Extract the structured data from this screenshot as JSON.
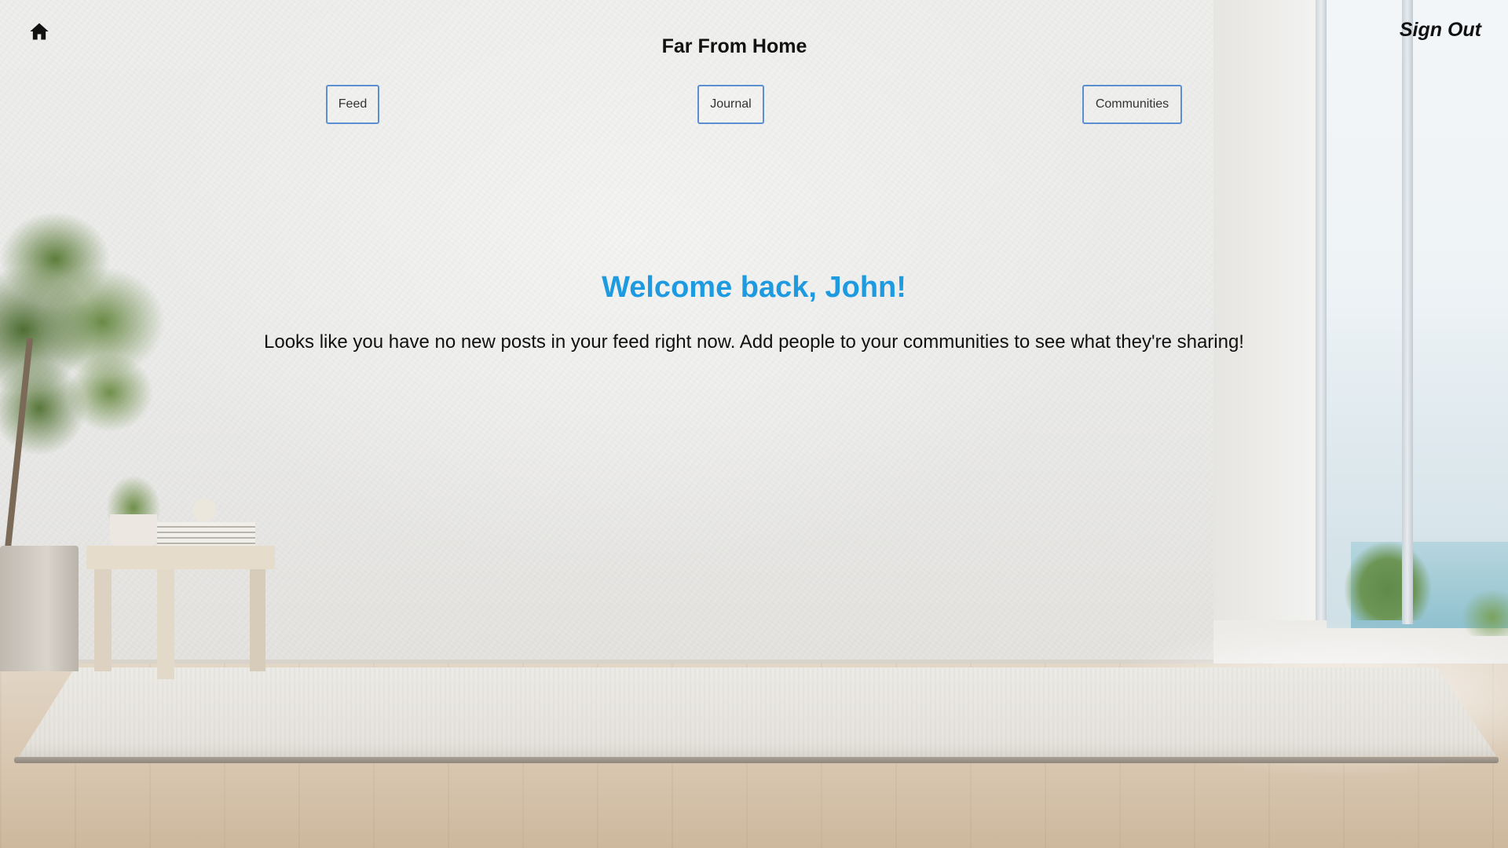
{
  "header": {
    "home_icon": "home-icon",
    "title": "Far From Home",
    "sign_out_label": "Sign Out"
  },
  "nav": {
    "items": [
      {
        "label": "Feed"
      },
      {
        "label": "Journal"
      },
      {
        "label": "Communities"
      }
    ]
  },
  "main": {
    "heading": "Welcome back, John!",
    "message": "Looks like you have no new posts in your feed right now. Add people to your communities to see what they're sharing!"
  },
  "colors": {
    "accent": "#1e9be0",
    "button_border": "#5b8fd1",
    "text": "#111111"
  }
}
